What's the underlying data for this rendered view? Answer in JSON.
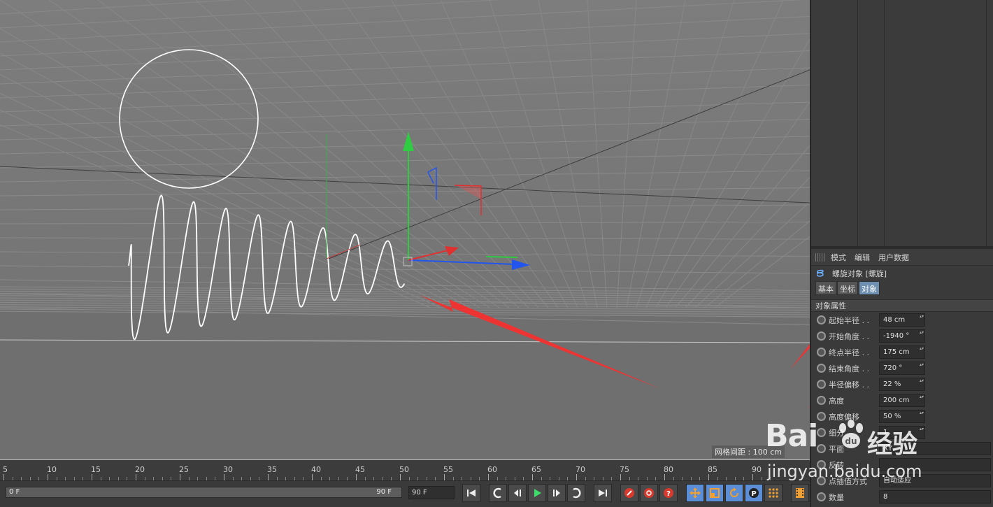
{
  "viewport": {
    "grid_spacing_label": "网格间距 : 100 cm"
  },
  "attributes": {
    "menu": [
      "模式",
      "编辑",
      "用户数据"
    ],
    "object_title": "螺旋对象 [螺旋]",
    "tabs": [
      {
        "label": "基本",
        "active": false
      },
      {
        "label": "坐标",
        "active": false
      },
      {
        "label": "对象",
        "active": true
      }
    ],
    "section_title": "对象属性",
    "properties": [
      {
        "label": "起始半径 . .",
        "value": "48 cm"
      },
      {
        "label": "开始角度 . .",
        "value": "-1940 °"
      },
      {
        "label": "终点半径 . .",
        "value": "175 cm"
      },
      {
        "label": "结束角度 . .",
        "value": "720 °"
      },
      {
        "label": "半径偏移 . .",
        "value": "22 %"
      },
      {
        "label": "高度",
        "value": "200 cm"
      },
      {
        "label": "高度偏移",
        "value": "50 %"
      },
      {
        "label": "细分",
        "value": "1"
      },
      {
        "label": "平面",
        "value": "XY"
      },
      {
        "label": "反转",
        "value": ""
      },
      {
        "label": "点插值方式",
        "value": "自动适应"
      },
      {
        "label": "数量",
        "value": "8"
      }
    ]
  },
  "timeline": {
    "ticks": [
      "5",
      "10",
      "15",
      "20",
      "25",
      "30",
      "35",
      "40",
      "45",
      "50",
      "55",
      "60",
      "65",
      "70",
      "75",
      "80",
      "85",
      "90"
    ]
  },
  "transport": {
    "range_start": "0 F",
    "range_end": "90 F",
    "end_frame": "90 F"
  },
  "watermark": {
    "brand": "Bai",
    "brand_cn": "经验",
    "url": "jingyan.baidu.com"
  }
}
